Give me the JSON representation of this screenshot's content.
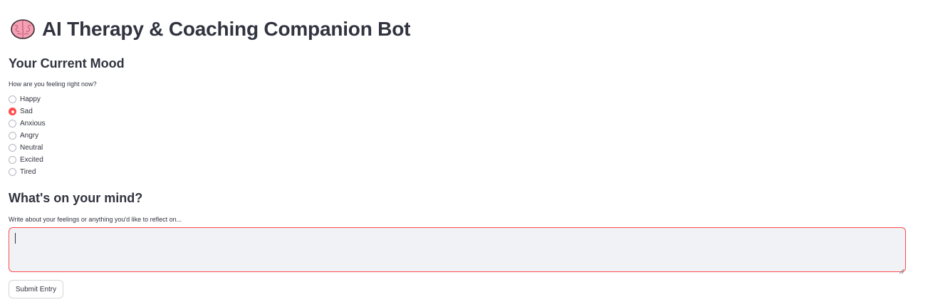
{
  "header": {
    "icon": "brain-icon",
    "title": "AI Therapy & Coaching Companion Bot"
  },
  "mood_section": {
    "heading": "Your Current Mood",
    "question": "How are you feeling right now?",
    "options": [
      "Happy",
      "Sad",
      "Anxious",
      "Angry",
      "Neutral",
      "Excited",
      "Tired"
    ],
    "selected": "Sad"
  },
  "mind_section": {
    "heading": "What's on your mind?",
    "prompt": "Write about your feelings or anything you'd like to reflect on...",
    "value": ""
  },
  "submit_label": "Submit Entry",
  "colors": {
    "accent": "#ff4b4b",
    "text": "#31333f",
    "input_bg": "#f0f2f6"
  }
}
